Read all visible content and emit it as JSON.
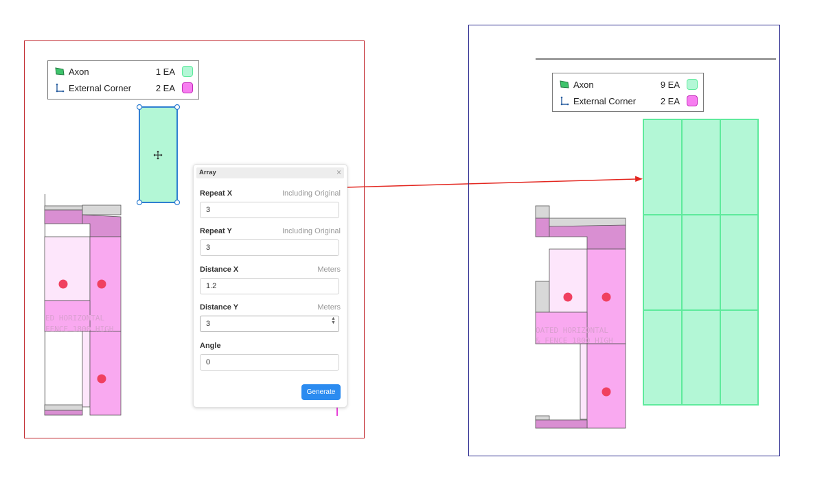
{
  "legend_before": {
    "items": [
      {
        "name": "Axon",
        "count": "1 EA",
        "icon": "axon-area-icon",
        "color": "#b3f7d6"
      },
      {
        "name": "External Corner",
        "count": "2 EA",
        "icon": "external-corner-icon",
        "color": "#f77ef0"
      }
    ]
  },
  "legend_after": {
    "items": [
      {
        "name": "Axon",
        "count": "9 EA",
        "icon": "axon-area-icon",
        "color": "#b3f7d6"
      },
      {
        "name": "External Corner",
        "count": "2 EA",
        "icon": "external-corner-icon",
        "color": "#f77ef0"
      }
    ]
  },
  "move_icon": "move-cross-icon",
  "array_panel": {
    "title": "Array",
    "close": "×",
    "repeat_x": {
      "label": "Repeat X",
      "hint": "Including Original",
      "value": "3"
    },
    "repeat_y": {
      "label": "Repeat Y",
      "hint": "Including Original",
      "value": "3"
    },
    "distance_x": {
      "label": "Distance X",
      "hint": "Meters",
      "value": "1.2"
    },
    "distance_y": {
      "label": "Distance Y",
      "hint": "Meters",
      "value": "3"
    },
    "angle": {
      "label": "Angle",
      "value": "0"
    },
    "generate_label": "Generate"
  },
  "drawing_text_before": {
    "line1": "ED  HORIZONTAL",
    "line2": "FENCE  1800  HIGH"
  },
  "drawing_text_after": {
    "line1": "OATED  HORIZONTAL",
    "line2": "&  FENCE  1800  HIGH"
  },
  "colors": {
    "axon_fill": "#b3f7d6",
    "axon_stroke": "#5eea9c",
    "corner_fill": "#f9a9f0",
    "selection_blue": "#2f7fd1",
    "left_frame": "#c1272d",
    "right_frame": "#2b2a8f",
    "arrow": "#e3261f",
    "generate_button": "#2b8bf0"
  }
}
